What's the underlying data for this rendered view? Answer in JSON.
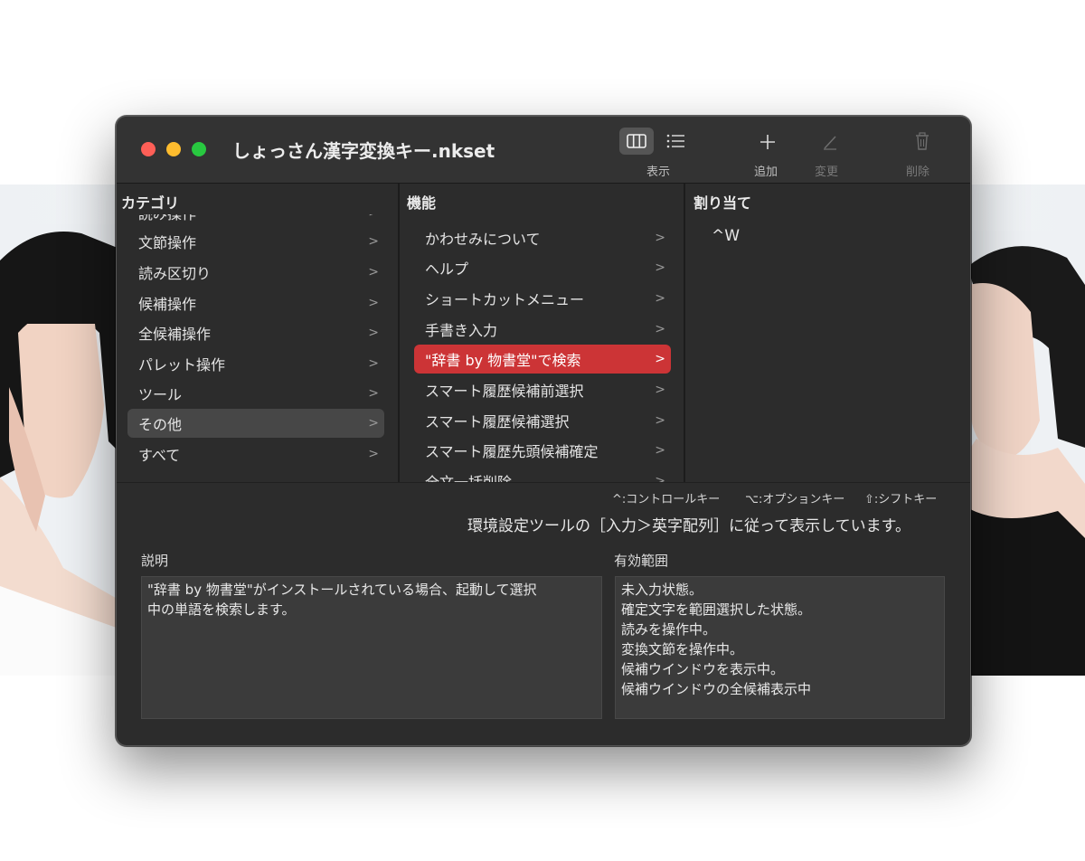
{
  "window": {
    "title": "しょっさん漢字変換キー.nkset"
  },
  "toolbar": {
    "view_label": "表示",
    "add_label": "追加",
    "edit_label": "変更",
    "delete_label": "削除"
  },
  "columns": {
    "category_header": "カテゴリ",
    "function_header": "機能",
    "assign_header": "割り当て"
  },
  "categories": [
    {
      "label": "読み操作"
    },
    {
      "label": "文節操作"
    },
    {
      "label": "読み区切り"
    },
    {
      "label": "候補操作"
    },
    {
      "label": "全候補操作"
    },
    {
      "label": "パレット操作"
    },
    {
      "label": "ツール"
    },
    {
      "label": "その他",
      "selected": true
    },
    {
      "label": "すべて"
    }
  ],
  "functions": [
    {
      "label": "かわせみについて"
    },
    {
      "label": "ヘルプ"
    },
    {
      "label": "ショートカットメニュー"
    },
    {
      "label": "手書き入力"
    },
    {
      "label": "\"辞書 by 物書堂\"で検索",
      "selected": true
    },
    {
      "label": "スマート履歴候補前選択"
    },
    {
      "label": "スマート履歴候補選択"
    },
    {
      "label": "スマート履歴先頭候補確定"
    },
    {
      "label": "全文一括削除"
    }
  ],
  "assignment": {
    "value": "^W"
  },
  "legend": {
    "control": "^:コントロールキー",
    "option": "⌥:オプションキー",
    "shift": "⇧:シフトキー"
  },
  "notice": "環境設定ツールの［入力＞英字配列］に従って表示しています。",
  "description": {
    "label": "説明",
    "lines": [
      "\"辞書 by 物書堂\"がインストールされている場合、起動して選択",
      "中の単語を検索します。"
    ]
  },
  "scope": {
    "label": "有効範囲",
    "lines": [
      "未入力状態。",
      "確定文字を範囲選択した状態。",
      "読みを操作中。",
      "変換文節を操作中。",
      "候補ウインドウを表示中。",
      "候補ウインドウの全候補表示中"
    ]
  },
  "colors": {
    "window_bg": "#2c2c2c",
    "selection_red": "#cc3436",
    "selection_gray": "#474747"
  }
}
